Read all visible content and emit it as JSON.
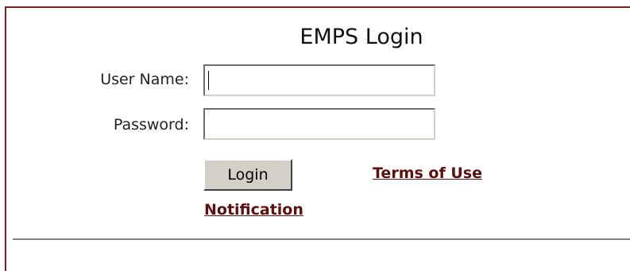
{
  "login_form": {
    "title": "EMPS Login",
    "username_label": "User Name:",
    "username_value": "",
    "password_label": "Password:",
    "password_value": "",
    "login_button_label": "Login",
    "terms_link_label": "Terms of Use",
    "notification_link_label": "Notification"
  },
  "colors": {
    "frame_border": "#7b2121",
    "link": "#5c0f0f",
    "button_face": "#d4d0c8",
    "divider": "#808080"
  }
}
